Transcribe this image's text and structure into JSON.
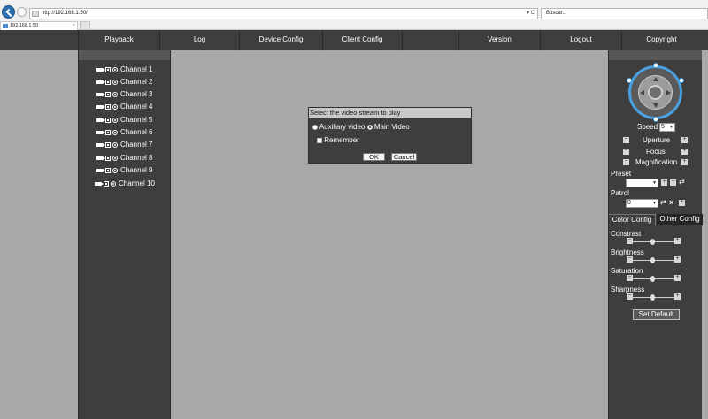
{
  "browser": {
    "url": "http://192.168.1.50/",
    "address_controls": "▾ C",
    "search_placeholder": "Buscar...",
    "tab_title": "192.168.1.50",
    "tab_close": "×"
  },
  "nav": {
    "items": [
      "Playback",
      "Log",
      "Device Config",
      "Client Config",
      "Version",
      "Logout",
      "Copyright"
    ]
  },
  "channels": [
    "Channel 1",
    "Channel 2",
    "Channel 3",
    "Channel 4",
    "Channel 5",
    "Channel 6",
    "Channel 7",
    "Channel 8",
    "Channel 9",
    "Channel 10"
  ],
  "ptz": {
    "speed_label": "Speed",
    "speed_value": "5",
    "controls": [
      "Uperture",
      "Focus",
      "Magnification"
    ],
    "preset_label": "Preset",
    "preset_value": "",
    "patrol_label": "Patrol",
    "patrol_value": "0"
  },
  "color": {
    "tabs": [
      "Color Config",
      "Other Config"
    ],
    "sliders": [
      {
        "label": "Constrast",
        "level": 0.5
      },
      {
        "label": "Brightness",
        "level": 0.5
      },
      {
        "label": "Saturation",
        "level": 0.5
      },
      {
        "label": "Sharpness",
        "level": 0.5
      }
    ],
    "set_default": "Set Default"
  },
  "dialog": {
    "title": "Select the video stream to play",
    "option_aux": "Auxiliary video",
    "option_main": "Main Video",
    "remember": "Remember",
    "ok": "OK",
    "cancel": "Cancel"
  }
}
